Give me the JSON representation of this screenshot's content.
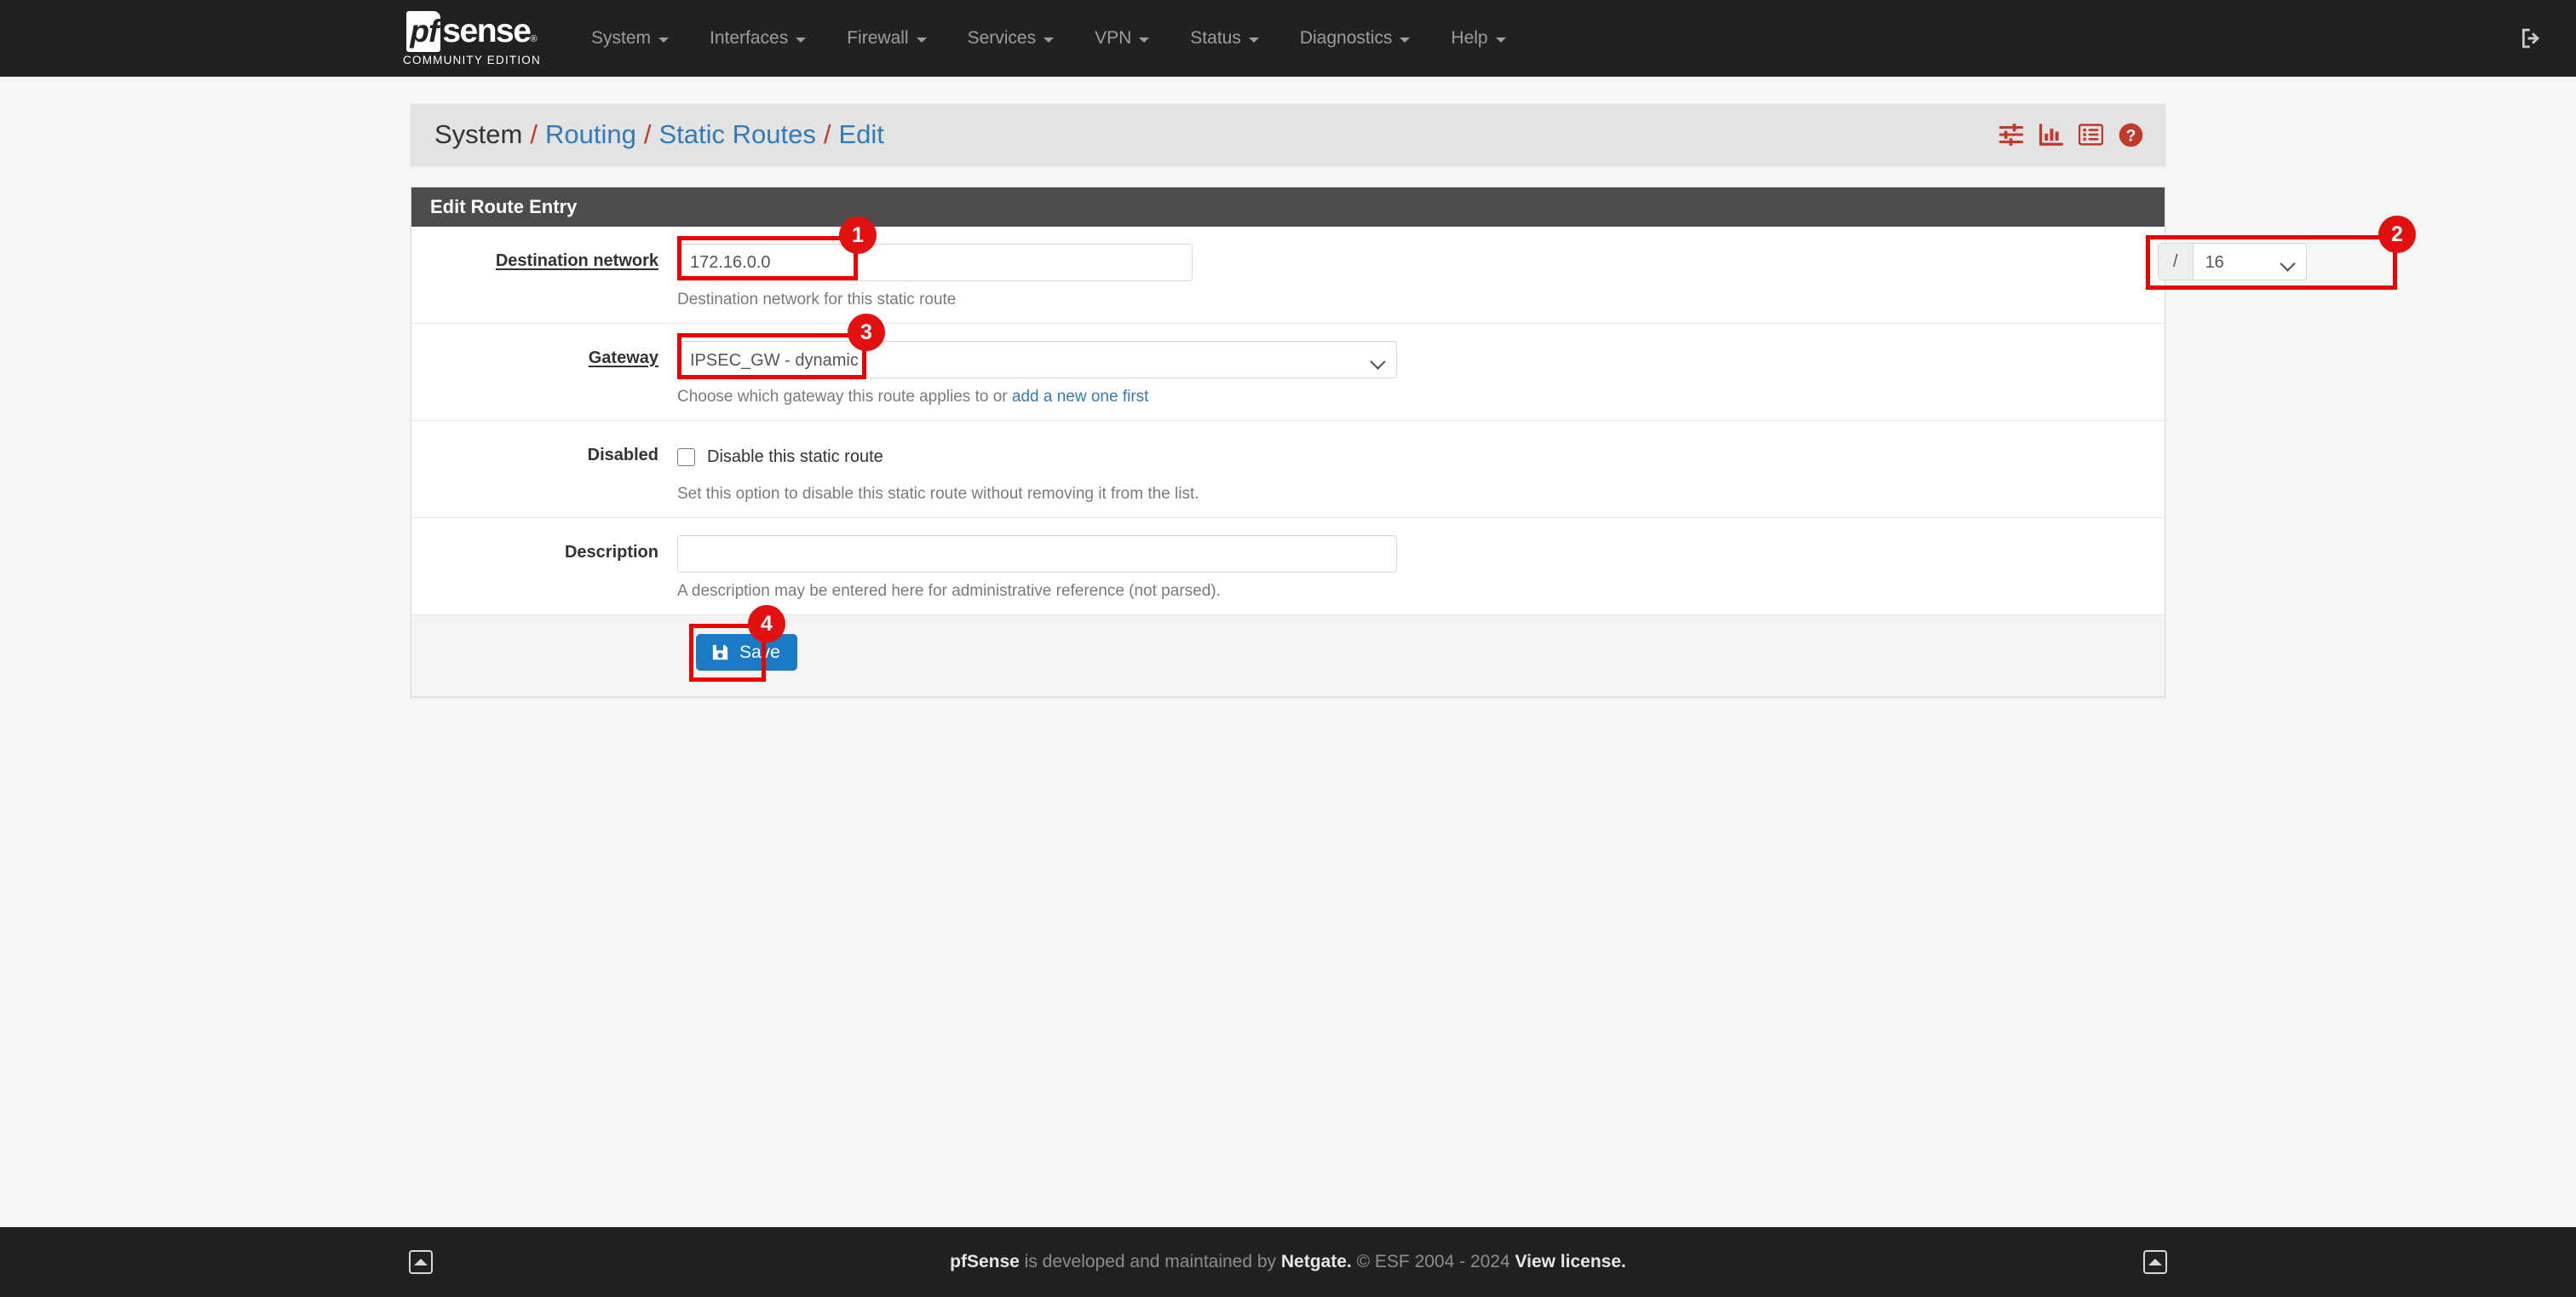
{
  "navbar": {
    "brand": {
      "pf": "pf",
      "sense": "sense",
      "subtitle": "COMMUNITY EDITION"
    },
    "items": [
      {
        "label": "System",
        "name": "nav-item-system"
      },
      {
        "label": "Interfaces",
        "name": "nav-item-interfaces"
      },
      {
        "label": "Firewall",
        "name": "nav-item-firewall"
      },
      {
        "label": "Services",
        "name": "nav-item-services"
      },
      {
        "label": "VPN",
        "name": "nav-item-vpn"
      },
      {
        "label": "Status",
        "name": "nav-item-status"
      },
      {
        "label": "Diagnostics",
        "name": "nav-item-diagnostics"
      },
      {
        "label": "Help",
        "name": "nav-item-help"
      }
    ],
    "logout_icon": "sign-out-icon"
  },
  "breadcrumb": {
    "items": [
      {
        "label": "System",
        "link": false
      },
      {
        "label": "Routing",
        "link": true
      },
      {
        "label": "Static Routes",
        "link": true
      },
      {
        "label": "Edit",
        "link": true
      }
    ],
    "separator": "/",
    "icons": [
      {
        "name": "sliders-icon"
      },
      {
        "name": "bar-chart-icon"
      },
      {
        "name": "list-icon"
      },
      {
        "name": "help-question-icon"
      }
    ]
  },
  "panel": {
    "title": "Edit Route Entry",
    "destination": {
      "label": "Destination network",
      "value": "172.16.0.0",
      "placeholder": "",
      "help": "Destination network for this static route",
      "cidr_prefix": "/",
      "cidr_value": "16"
    },
    "gateway": {
      "label": "Gateway",
      "value": "IPSEC_GW - dynamic",
      "help_prefix": "Choose which gateway this route applies to or ",
      "help_link": "add a new one first"
    },
    "disabled": {
      "label": "Disabled",
      "checkbox_label": "Disable this static route",
      "checked": false,
      "help": "Set this option to disable this static route without removing it from the list."
    },
    "description": {
      "label": "Description",
      "value": "",
      "placeholder": "",
      "help": "A description may be entered here for administrative reference (not parsed)."
    },
    "save_label": "Save",
    "save_icon": "floppy-save-icon"
  },
  "annotations": [
    {
      "number": "1",
      "target": "destination-network-input"
    },
    {
      "number": "2",
      "target": "cidr-select"
    },
    {
      "number": "3",
      "target": "gateway-select"
    },
    {
      "number": "4",
      "target": "save-button"
    }
  ],
  "footer": {
    "brand": "pfSense",
    "text_mid": " is developed and maintained by ",
    "company": "Netgate.",
    "copyright": " © ESF 2004 - 2024 ",
    "license": "View license.",
    "scroll_icon": "scroll-to-top-icon"
  },
  "colors": {
    "navbar_bg": "#212121",
    "panel_heading_bg": "#4c4c4c",
    "link_blue": "#337ab7",
    "accent_red": "#c0392b",
    "annotation_red": "#ee0000",
    "save_blue": "#1a7bc4"
  }
}
